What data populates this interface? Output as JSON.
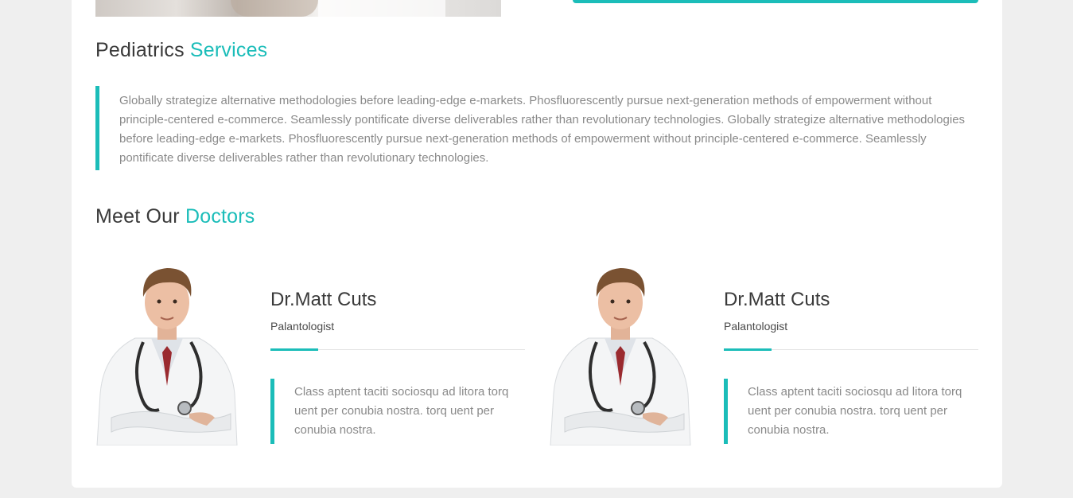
{
  "services": {
    "title_plain": "Pediatrics",
    "title_accent": "Services",
    "description": "Globally strategize alternative methodologies before leading-edge e-markets. Phosfluorescently pursue next-generation methods of empowerment without principle-centered e-commerce. Seamlessly pontificate diverse deliverables rather than revolutionary technologies. Globally strategize alternative methodologies before leading-edge e-markets. Phosfluorescently pursue next-generation methods of empowerment without principle-centered e-commerce. Seamlessly pontificate diverse deliverables rather than revolutionary technologies."
  },
  "doctors_section": {
    "title_plain": "Meet Our",
    "title_accent": "Doctors"
  },
  "doctors": [
    {
      "name": "Dr.Matt Cuts",
      "role": "Palantologist",
      "quote": "Class aptent taciti sociosqu ad litora torq uent per conubia nostra. torq uent per conubia nostra."
    },
    {
      "name": "Dr.Matt Cuts",
      "role": "Palantologist",
      "quote": "Class aptent taciti sociosqu ad litora torq uent per conubia nostra. torq uent per conubia nostra."
    }
  ],
  "colors": {
    "accent": "#1bbdb9",
    "heading": "#3a3a3a",
    "body_text": "#8a8a8a",
    "page_background": "#efefef",
    "card_background": "#ffffff"
  }
}
